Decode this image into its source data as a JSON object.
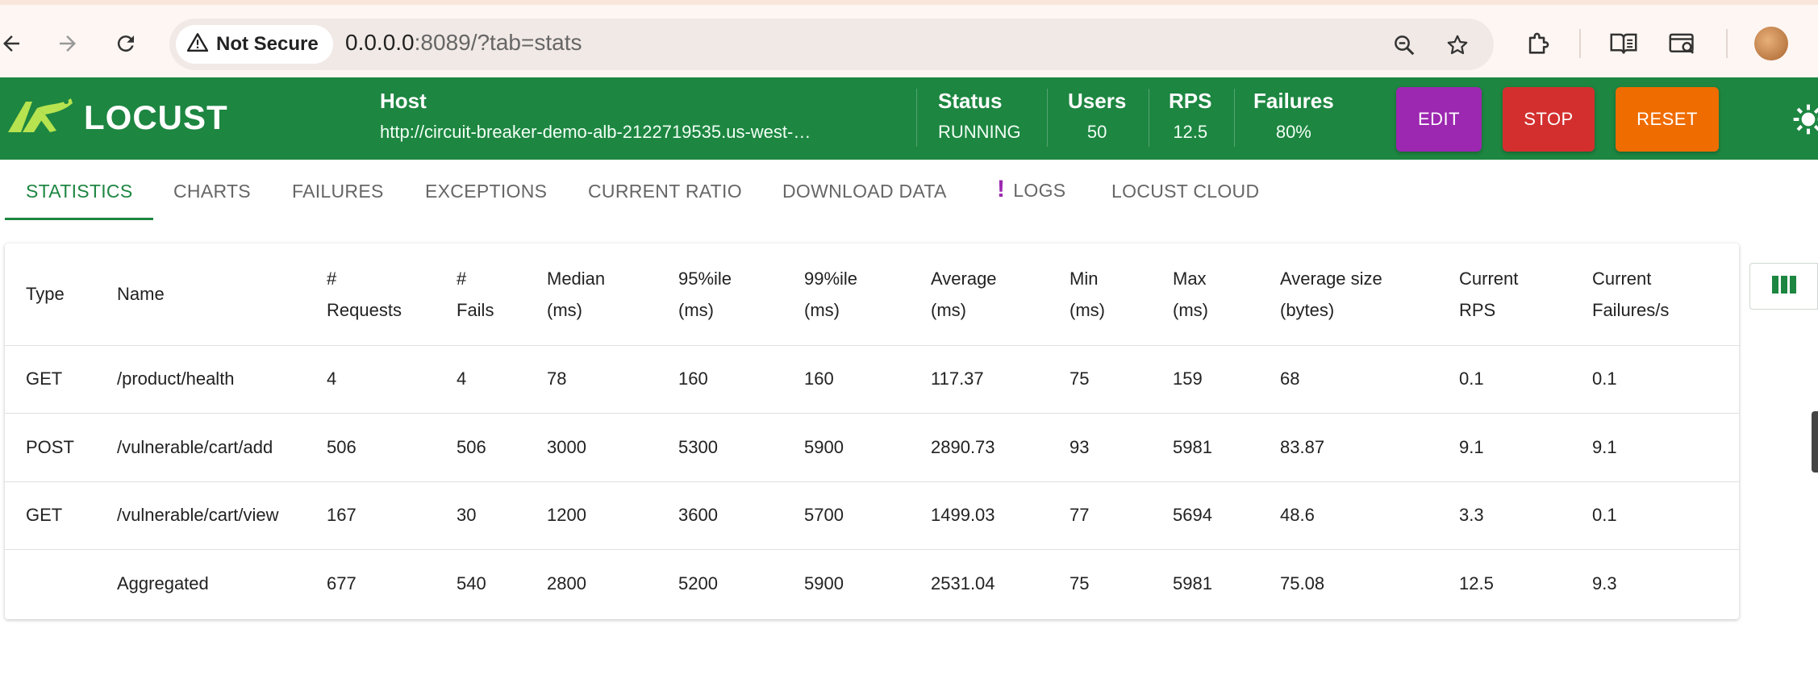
{
  "browser": {
    "security_label": "Not Secure",
    "url_host": "0.0.0.0",
    "url_rest": ":8089/?tab=stats"
  },
  "header": {
    "logo_text": "LOCUST",
    "host_label": "Host",
    "host_value": "http://circuit-breaker-demo-alb-2122719535.us-west-…",
    "status_label": "Status",
    "status_value": "RUNNING",
    "users_label": "Users",
    "users_value": "50",
    "rps_label": "RPS",
    "rps_value": "12.5",
    "failures_label": "Failures",
    "failures_value": "80%",
    "edit_label": "EDIT",
    "stop_label": "STOP",
    "reset_label": "RESET",
    "accent": "#1d8641"
  },
  "tabs": [
    {
      "label": "STATISTICS"
    },
    {
      "label": "CHARTS"
    },
    {
      "label": "FAILURES"
    },
    {
      "label": "EXCEPTIONS"
    },
    {
      "label": "CURRENT RATIO"
    },
    {
      "label": "DOWNLOAD DATA"
    },
    {
      "label": "LOGS"
    },
    {
      "label": "LOCUST CLOUD"
    }
  ],
  "table": {
    "columns": [
      {
        "l1": "Type",
        "l2": ""
      },
      {
        "l1": "Name",
        "l2": ""
      },
      {
        "l1": "#",
        "l2": "Requests"
      },
      {
        "l1": "#",
        "l2": "Fails"
      },
      {
        "l1": "Median",
        "l2": "(ms)"
      },
      {
        "l1": "95%ile",
        "l2": "(ms)"
      },
      {
        "l1": "99%ile",
        "l2": "(ms)"
      },
      {
        "l1": "Average",
        "l2": "(ms)"
      },
      {
        "l1": "Min",
        "l2": "(ms)"
      },
      {
        "l1": "Max",
        "l2": "(ms)"
      },
      {
        "l1": "Average size",
        "l2": "(bytes)"
      },
      {
        "l1": "Current",
        "l2": "RPS"
      },
      {
        "l1": "Current",
        "l2": "Failures/s"
      }
    ],
    "rows": [
      [
        "GET",
        "/product/health",
        "4",
        "4",
        "78",
        "160",
        "160",
        "117.37",
        "75",
        "159",
        "68",
        "0.1",
        "0.1"
      ],
      [
        "POST",
        "/vulnerable/cart/add",
        "506",
        "506",
        "3000",
        "5300",
        "5900",
        "2890.73",
        "93",
        "5981",
        "83.87",
        "9.1",
        "9.1"
      ],
      [
        "GET",
        "/vulnerable/cart/view",
        "167",
        "30",
        "1200",
        "3600",
        "5700",
        "1499.03",
        "77",
        "5694",
        "48.6",
        "3.3",
        "0.1"
      ],
      [
        "",
        "Aggregated",
        "677",
        "540",
        "2800",
        "5200",
        "5900",
        "2531.04",
        "75",
        "5981",
        "75.08",
        "12.5",
        "9.3"
      ]
    ]
  }
}
